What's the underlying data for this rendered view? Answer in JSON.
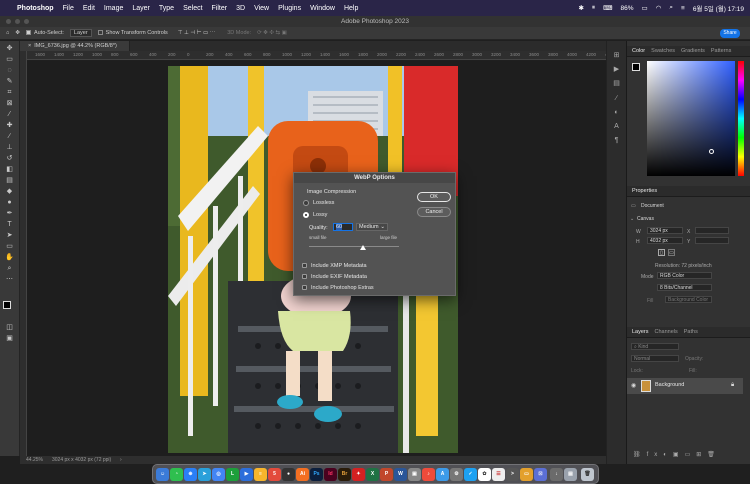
{
  "menubar": {
    "apple": "",
    "app_name": "Photoshop",
    "items": [
      "File",
      "Edit",
      "Image",
      "Layer",
      "Type",
      "Select",
      "Filter",
      "3D",
      "View",
      "Plugins",
      "Window",
      "Help"
    ],
    "battery": "86%",
    "datetime": "6월 5일 (월) 17:19"
  },
  "window": {
    "title": "Adobe Photoshop 2023"
  },
  "options_bar": {
    "auto_select_label": "Auto-Select:",
    "auto_select_value": "Layer",
    "show_transform_label": "Show Transform Controls",
    "mode_3d": "3D Mode:",
    "share": "Share"
  },
  "document_tab": {
    "label": "IMG_6736.jpg @ 44.2% (RGB/8*)"
  },
  "ruler": {
    "ticks": [
      "1600",
      "1400",
      "1200",
      "1000",
      "800",
      "600",
      "400",
      "200",
      "0",
      "200",
      "400",
      "600",
      "800",
      "1000",
      "1200",
      "1400",
      "1600",
      "1800",
      "2000",
      "2200",
      "2400",
      "2600",
      "2800",
      "3000",
      "3200",
      "3400",
      "3600",
      "3800",
      "4000",
      "4200",
      "4400"
    ]
  },
  "status": {
    "zoom": "44.25%",
    "doc_info": "3024 px x 4032 px (72 ppi)"
  },
  "dialog": {
    "title": "WebP Options",
    "group_label": "Image Compression",
    "lossless": "Lossless",
    "lossy": "Lossy",
    "quality_label": "Quality:",
    "quality_value": "60",
    "quality_preset": "Medium",
    "small_file": "small file",
    "large_file": "large file",
    "slider_fraction": 0.6,
    "include_xmp": "Include XMP Metadata",
    "include_exif": "Include EXIF Metadata",
    "include_ps_extras": "Include Photoshop Extras",
    "ok": "OK",
    "cancel": "Cancel"
  },
  "color_panel": {
    "tabs": [
      "Color",
      "Swatches",
      "Gradients",
      "Patterns"
    ]
  },
  "properties": {
    "tab": "Properties",
    "section_doc": "Document",
    "section_canvas": "Canvas",
    "w_label": "W",
    "w_value": "3024 px",
    "h_label": "H",
    "h_value": "4032 px",
    "x_label": "X",
    "y_label": "Y",
    "resolution": "Resolution: 72 pixels/inch",
    "mode_label": "Mode",
    "mode_value": "RGB Color",
    "bits_value": "8 Bits/Channel",
    "fill_label": "Fill",
    "fill_value": "Background Color"
  },
  "layers": {
    "tabs": [
      "Layers",
      "Channels",
      "Paths"
    ],
    "kind": "Kind",
    "blend": "Normal",
    "opacity_label": "Opacity:",
    "lock_label": "Lock:",
    "fill_label": "Fill:",
    "layer_name": "Background"
  },
  "colors": {
    "accent": "#1473e6",
    "menubar": "#2a2548"
  }
}
